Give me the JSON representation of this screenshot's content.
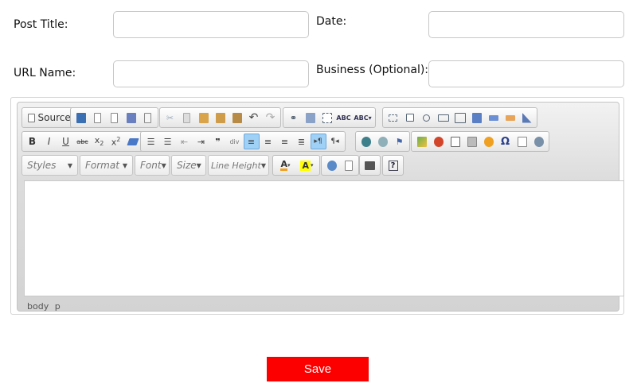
{
  "form": {
    "post_title_label": "Post Title:",
    "date_label": "Date:",
    "url_name_label": "URL Name:",
    "business_label": "Business (Optional):",
    "post_title_value": "",
    "date_value": "",
    "url_name_value": "",
    "business_value": ""
  },
  "editor": {
    "source_label": "Source",
    "combos": {
      "styles": "Styles",
      "format": "Format",
      "font": "Font",
      "size": "Size",
      "line_height": "Line Height"
    },
    "path_body": "body",
    "path_p": "p",
    "colors": {
      "active_button": "#9fd0f5",
      "toolbar_bg": "#dcdcdc"
    }
  },
  "actions": {
    "save_label": "Save",
    "save_color": "#fc0000"
  }
}
